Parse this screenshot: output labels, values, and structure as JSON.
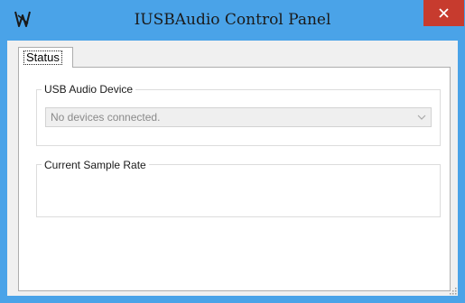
{
  "window": {
    "title": "IUSBAudio Control Panel",
    "app_icon": "audio-app-icon",
    "close_icon": "close-icon",
    "frame_color": "#4aa3e8",
    "close_color": "#c73b2e"
  },
  "tabs": [
    {
      "label": "Status",
      "selected": true
    }
  ],
  "status": {
    "usb_group": {
      "label": "USB Audio Device",
      "dropdown": {
        "selected": "No devices connected.",
        "icon": "chevron-down-icon",
        "enabled": false
      }
    },
    "rate_group": {
      "label": "Current Sample Rate"
    }
  }
}
